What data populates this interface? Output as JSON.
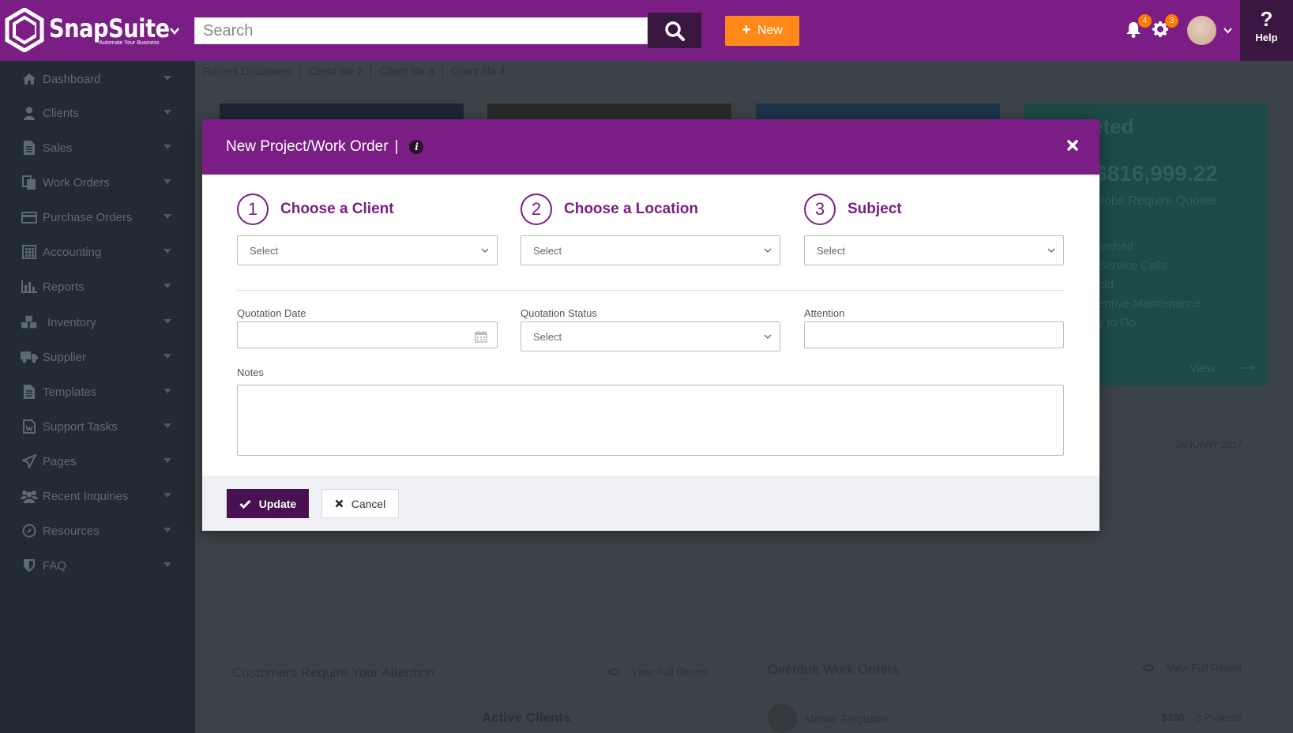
{
  "brand": {
    "name": "SnapSuite",
    "tagline": "Automate Your Business"
  },
  "header": {
    "search_placeholder": "Search",
    "new_label": "New",
    "notifications_count": "4",
    "settings_count": "3",
    "help_label": "Help"
  },
  "sidebar": {
    "items": [
      {
        "label": "Dashboard",
        "icon": "home-icon"
      },
      {
        "label": "Clients",
        "icon": "user-icon"
      },
      {
        "label": "Sales",
        "icon": "document-icon"
      },
      {
        "label": "Work Orders",
        "icon": "copy-icon"
      },
      {
        "label": "Purchase Orders",
        "icon": "credit-card-icon"
      },
      {
        "label": "Accounting",
        "icon": "calculator-icon"
      },
      {
        "label": "Reports",
        "icon": "bar-chart-icon"
      },
      {
        "label": "Inventory",
        "icon": "cubes-icon"
      },
      {
        "label": "Supplier",
        "icon": "truck-icon"
      },
      {
        "label": "Templates",
        "icon": "file-text-icon"
      },
      {
        "label": "Support Tasks",
        "icon": "word-file-icon"
      },
      {
        "label": "Pages",
        "icon": "paper-plane-icon"
      },
      {
        "label": "Recent Inquiries",
        "icon": "users-icon"
      },
      {
        "label": "Resources",
        "icon": "compass-icon"
      },
      {
        "label": "FAQ",
        "icon": "shield-icon"
      }
    ]
  },
  "breadcrumbs": [
    "Recent Document",
    "Client file 2",
    "Client file 3",
    "Client file 4"
  ],
  "background": {
    "card_heading": "eted",
    "card_amount": "$816,999.22",
    "card_sub": "Jobs Require Quotes",
    "card_lines": [
      "atched",
      "Service Calls",
      "old",
      "entive Maintenance",
      "y to Go"
    ],
    "card_view": "View",
    "month_label": "JANUARY 2017",
    "customers_title": "Customers Require Your Attention",
    "overdue_title": "Overdue Work Orders",
    "view_full_report": "View Full Report",
    "active_clients": "Active Clients",
    "row_name": "Minnie Ferguson",
    "row_amount": "$150",
    "row_projects": "3 Projects"
  },
  "modal": {
    "title": "New Project/Work Order",
    "title_separator": "|",
    "steps": [
      {
        "num": "1",
        "label": "Choose a Client",
        "value": "Select"
      },
      {
        "num": "2",
        "label": "Choose a Location",
        "value": "Select"
      },
      {
        "num": "3",
        "label": "Subject",
        "value": "Select"
      }
    ],
    "quotation_date_label": "Quotation Date",
    "quotation_date_value": "",
    "quotation_status_label": "Quotation Status",
    "quotation_status_value": "Select",
    "attention_label": "Attention",
    "attention_value": "",
    "notes_label": "Notes",
    "notes_value": "",
    "update_label": "Update",
    "cancel_label": "Cancel"
  },
  "colors": {
    "brand_purple": "#7a1e85",
    "dark_purple": "#3a1740",
    "accent_orange": "#ff8a1a",
    "sidebar_bg": "#222a33"
  }
}
